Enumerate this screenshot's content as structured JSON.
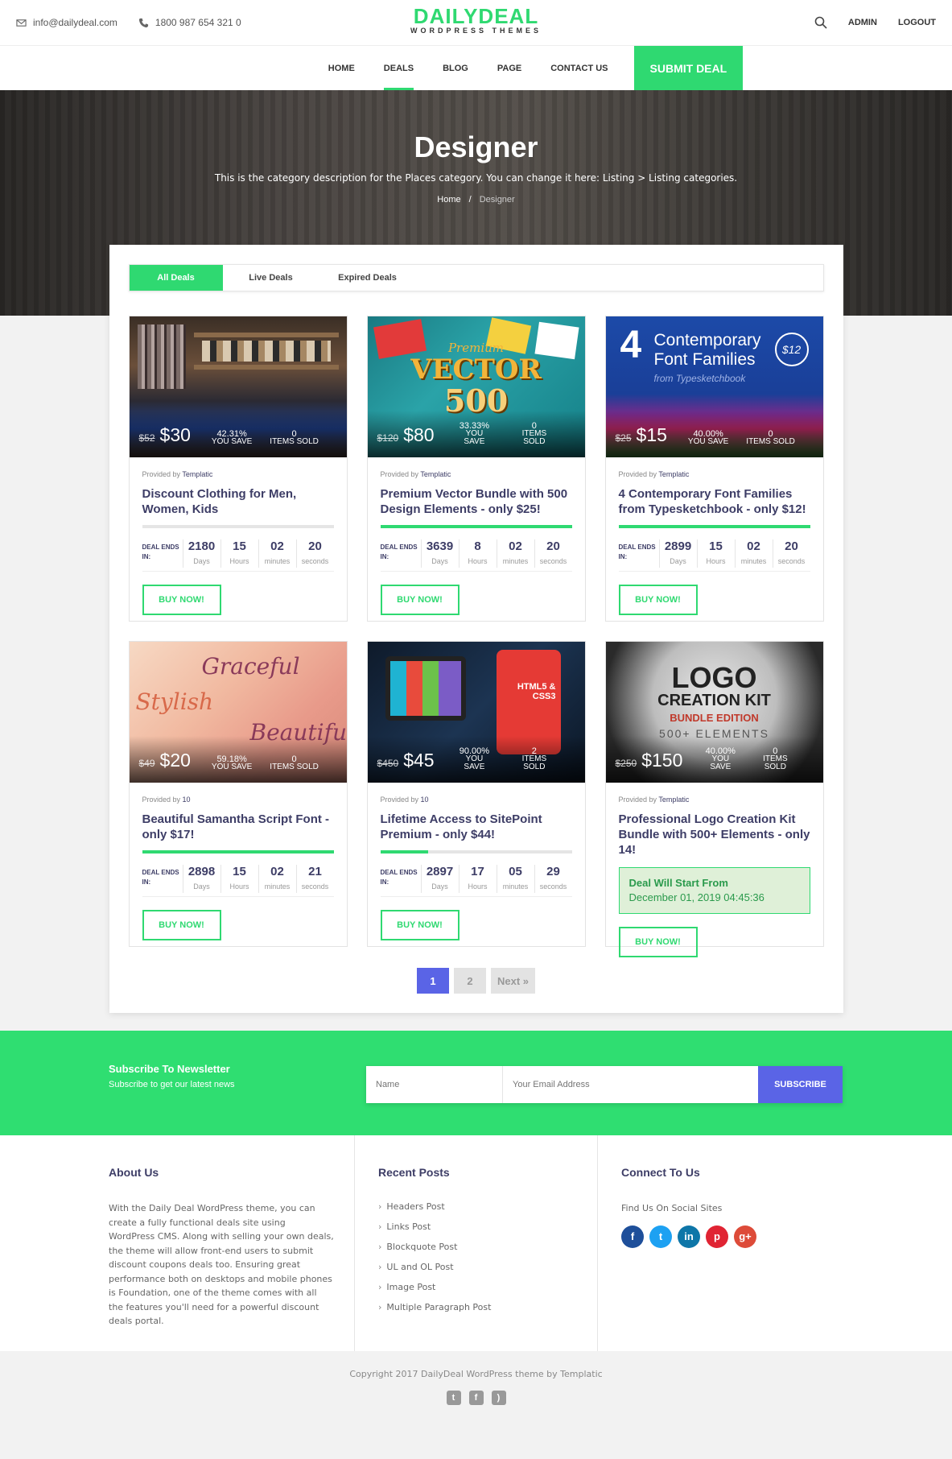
{
  "topbar": {
    "email": "info@dailydeal.com",
    "phone": "1800 987 654 321 0",
    "logo_main": "DAILYDEAL",
    "logo_sub": "WORDPRESS THEMES",
    "admin": "ADMIN",
    "logout": "LOGOUT"
  },
  "nav": {
    "items": [
      "HOME",
      "DEALS",
      "BLOG",
      "PAGE",
      "CONTACT US"
    ],
    "submit": "SUBMIT DEAL"
  },
  "hero": {
    "title": "Designer",
    "description": "This is the category description for the Places category. You can change it here: Listing > Listing categories.",
    "crumb_home": "Home",
    "crumb_sep": "/",
    "crumb_current": "Designer"
  },
  "tabs": [
    "All Deals",
    "Live Deals",
    "Expired Deals"
  ],
  "deal_ends_label": "DEAL ENDS IN:",
  "unit_labels": [
    "Days",
    "Hours",
    "minutes",
    "seconds"
  ],
  "provided_label": "Provided by",
  "buy_label": "BUY NOW!",
  "you_save_label": "YOU SAVE",
  "items_sold_label": "ITEMS SOLD",
  "deals": [
    {
      "old": "$52",
      "price": "$30",
      "save": "42.31%",
      "sold": "0",
      "provider": "Templatic",
      "title": "Discount Clothing for Men, Women, Kids",
      "progress": 0,
      "cd": [
        "2180",
        "15",
        "02",
        "20"
      ]
    },
    {
      "old": "$120",
      "price": "$80",
      "save": "33.33%",
      "sold": "0",
      "provider": "Templatic",
      "title": "Premium Vector Bundle with 500 Design Elements - only $25!",
      "progress": 100,
      "cd": [
        "3639",
        "8",
        "02",
        "20"
      ]
    },
    {
      "old": "$25",
      "price": "$15",
      "save": "40.00%",
      "sold": "0",
      "provider": "Templatic",
      "title": "4 Contemporary Font Families from Typesketchbook - only $12!",
      "progress": 100,
      "cd": [
        "2899",
        "15",
        "02",
        "20"
      ]
    },
    {
      "old": "$49",
      "price": "$20",
      "save": "59.18%",
      "sold": "0",
      "provider": "10",
      "title": "Beautiful Samantha Script Font - only $17!",
      "progress": 100,
      "cd": [
        "2898",
        "15",
        "02",
        "21"
      ]
    },
    {
      "old": "$450",
      "price": "$45",
      "save": "90.00%",
      "sold": "2",
      "provider": "10",
      "title": "Lifetime Access to SitePoint Premium - only $44!",
      "progress": 25,
      "cd": [
        "2897",
        "17",
        "05",
        "29"
      ]
    },
    {
      "old": "$250",
      "price": "$150",
      "save": "40.00%",
      "sold": "0",
      "provider": "Templatic",
      "title": "Professional Logo Creation Kit Bundle with 500+ Elements - only 14!",
      "start_title": "Deal Will Start From",
      "start_date": "December 01, 2019 04:45:36"
    }
  ],
  "images": {
    "font4": "4",
    "font_title1": "Contemporary",
    "font_title2": "Font Families",
    "font_from": "from Typesketchbook",
    "font_badge": "$12",
    "vector1": "Premium",
    "vector2": "VECTOR",
    "vector3": "500",
    "logo1": "LOGO",
    "logo2": "CREATION KIT",
    "logo3": "BUNDLE EDITION",
    "logo4": "500+ ELEMENTS",
    "script1": "Graceful",
    "script2": "Stylish",
    "script3": "Beautiful",
    "html5": "HTML5 & CSS3"
  },
  "pager": [
    "1",
    "2",
    "Next »"
  ],
  "newsletter": {
    "title": "Subscribe To Newsletter",
    "subtitle": "Subscribe to get our latest news",
    "name_placeholder": "Name",
    "email_placeholder": "Your Email Address",
    "button": "SUBSCRIBE"
  },
  "footer": {
    "about_title": "About Us",
    "about_text": "With the Daily Deal WordPress theme, you can create a fully functional deals site using WordPress CMS. Along with selling your own deals, the theme will allow front-end users to submit discount coupons deals too. Ensuring great performance both on desktops and mobile phones is Foundation, one of the theme comes with all the features you'll need for a powerful discount deals portal.",
    "posts_title": "Recent Posts",
    "posts": [
      "Headers Post",
      "Links Post",
      "Blockquote Post",
      "UL and OL Post",
      "Image Post",
      "Multiple Paragraph Post"
    ],
    "connect_title": "Connect To Us",
    "connect_sub": "Find Us On Social Sites",
    "social": [
      {
        "name": "facebook-icon",
        "glyph": "f",
        "color": "#1e4f9a"
      },
      {
        "name": "twitter-icon",
        "glyph": "t",
        "color": "#1da1f2"
      },
      {
        "name": "linkedin-icon",
        "glyph": "in",
        "color": "#0e76a8"
      },
      {
        "name": "pinterest-icon",
        "glyph": "p",
        "color": "#e02433"
      },
      {
        "name": "googleplus-icon",
        "glyph": "g+",
        "color": "#dd4b39"
      }
    ],
    "copyright": "Copyright 2017 DailyDeal WordPress theme by Templatic"
  },
  "colors": {
    "accent": "#2fd971",
    "primary": "#5a64e6",
    "text": "#3d3d66"
  }
}
